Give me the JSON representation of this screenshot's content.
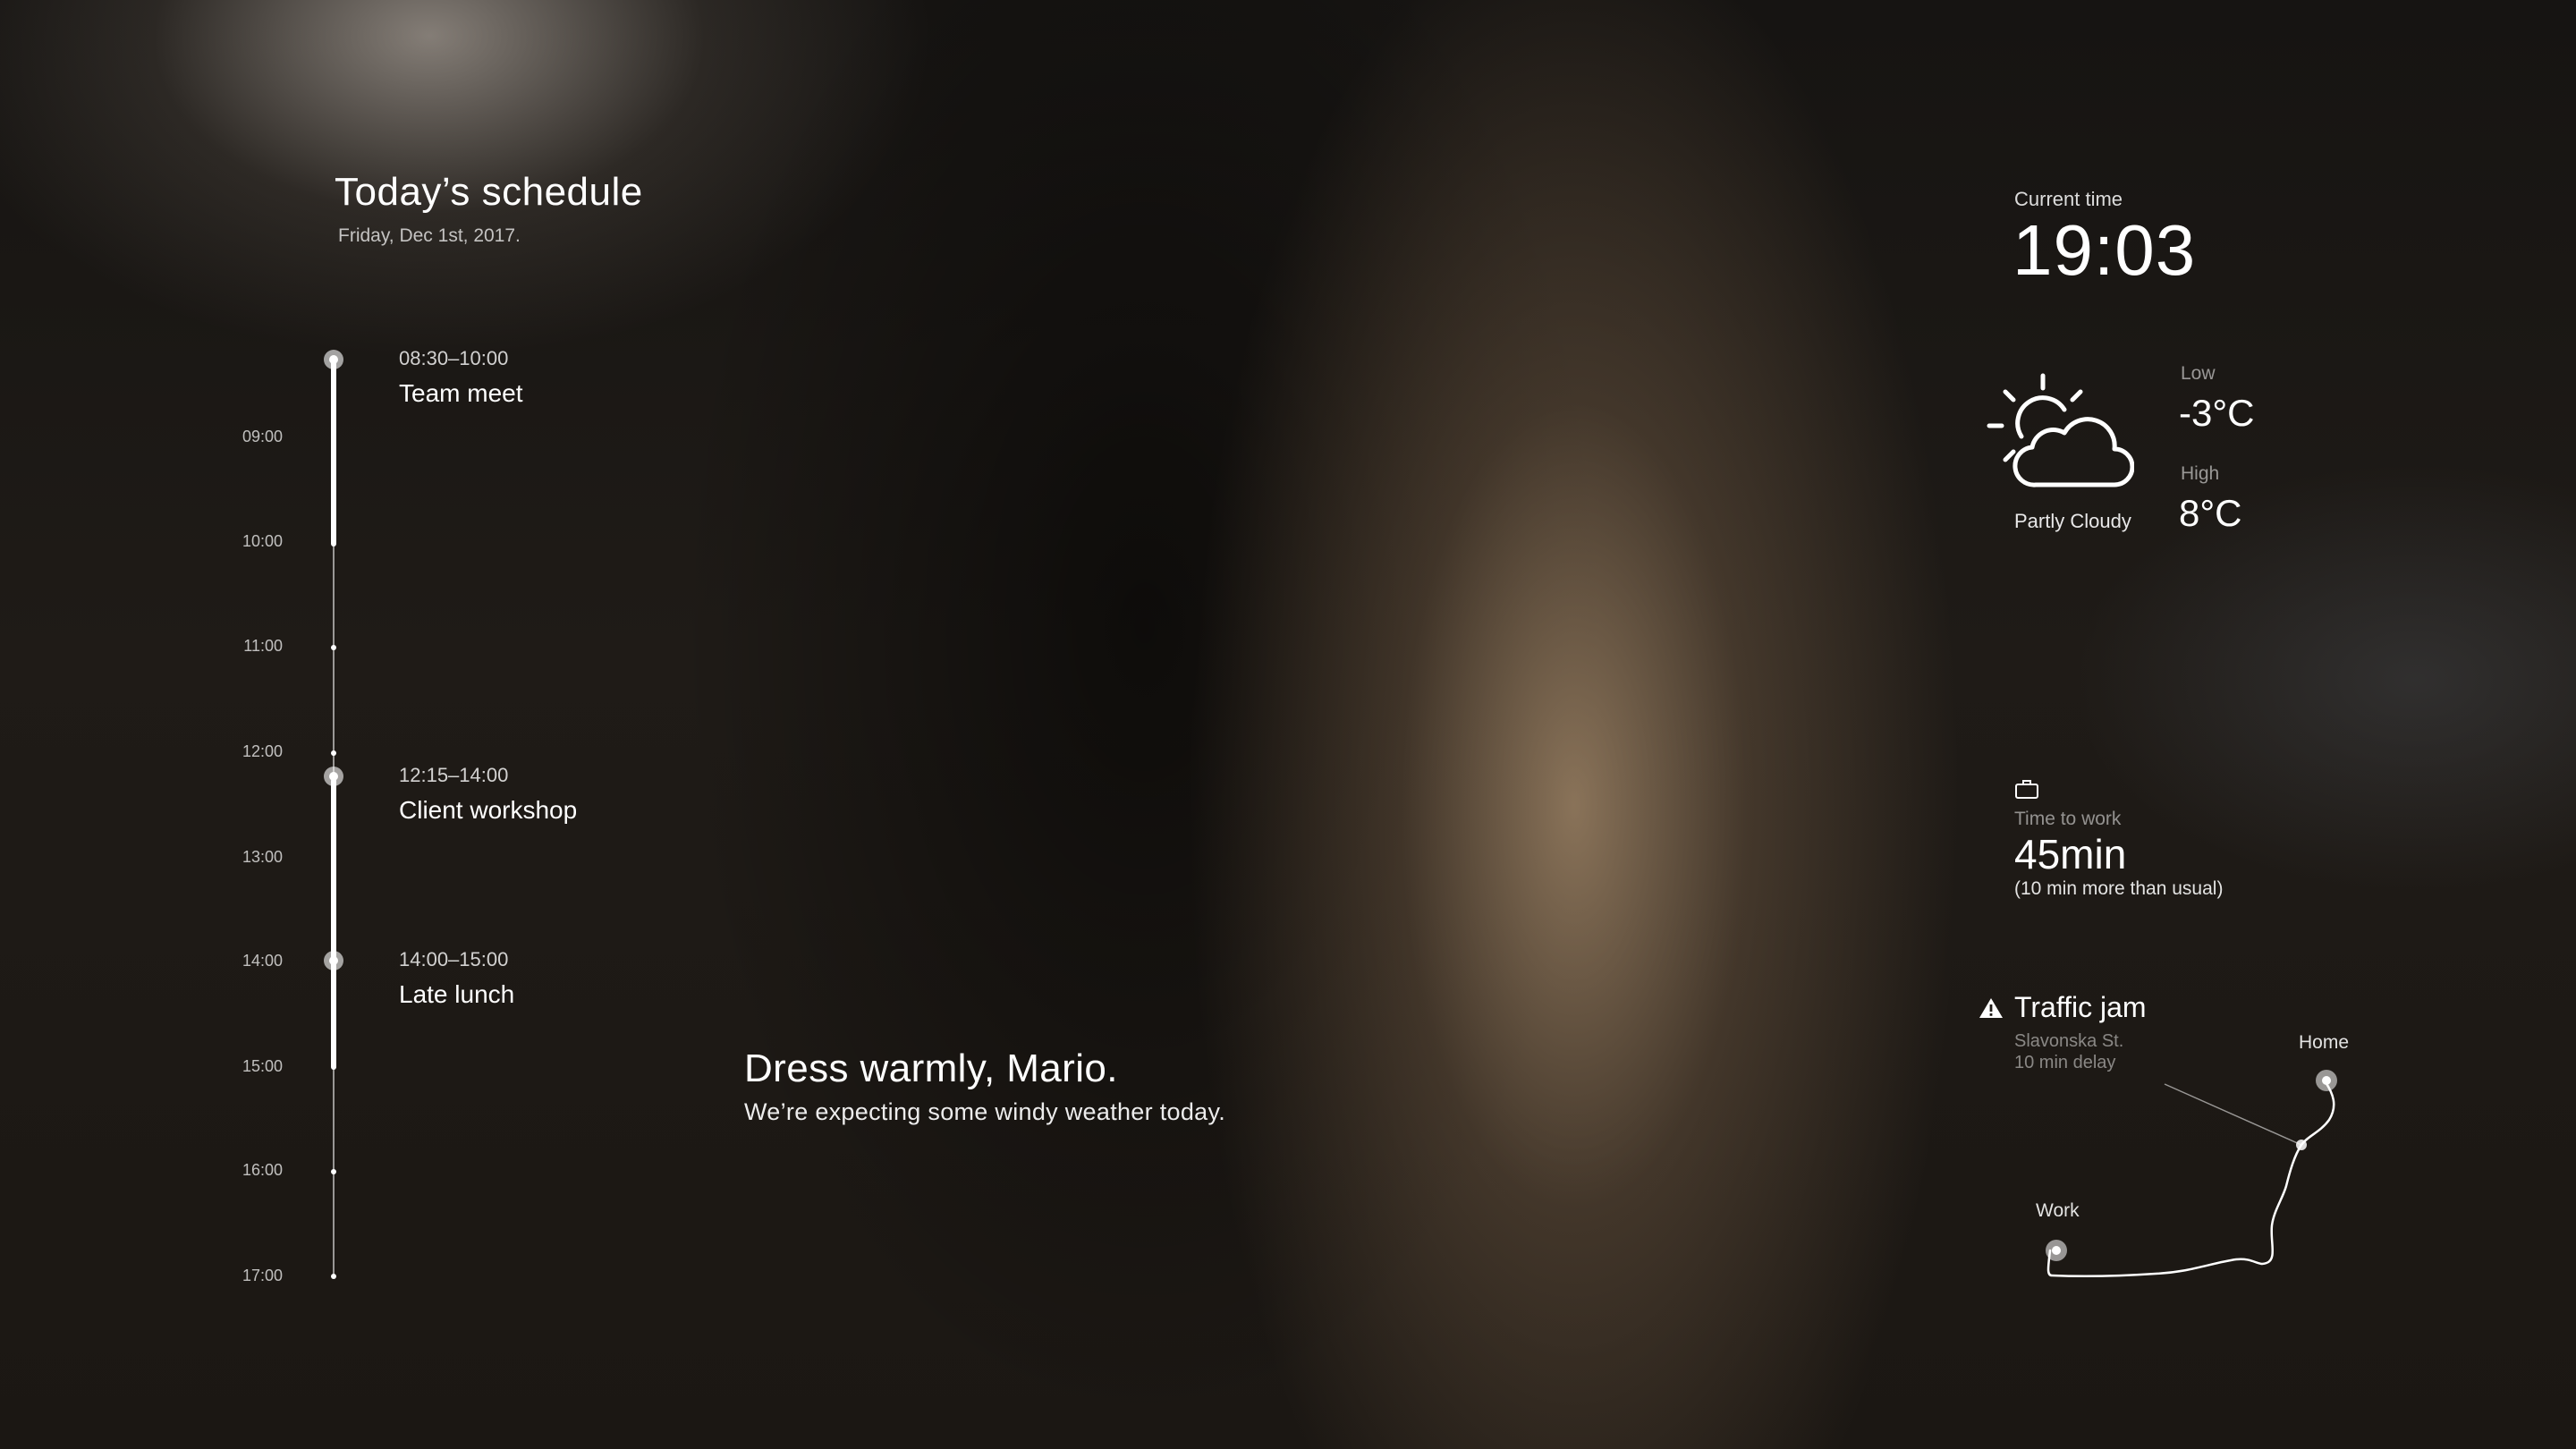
{
  "schedule": {
    "title": "Today’s schedule",
    "date": "Friday, Dec 1st, 2017.",
    "hours": [
      "09:00",
      "10:00",
      "11:00",
      "12:00",
      "13:00",
      "14:00",
      "15:00",
      "16:00",
      "17:00"
    ],
    "events": [
      {
        "time": "08:30–10:00",
        "name": "Team meet"
      },
      {
        "time": "12:15–14:00",
        "name": "Client workshop"
      },
      {
        "time": "14:00–15:00",
        "name": "Late lunch"
      }
    ]
  },
  "message": {
    "title": "Dress warmly, Mario.",
    "subtitle": "We’re expecting some windy weather today."
  },
  "clock": {
    "label": "Current time",
    "value": "19:03"
  },
  "weather": {
    "icon": "partly-cloudy-icon",
    "condition": "Partly Cloudy",
    "low_label": "Low",
    "low_value": "-3°C",
    "high_label": "High",
    "high_value": "8°C"
  },
  "commute": {
    "icon": "briefcase-icon",
    "label": "Time to work",
    "value": "45min",
    "note": "(10 min more than usual)"
  },
  "traffic": {
    "icon": "warning-icon",
    "title": "Traffic jam",
    "street": "Slavonska St.",
    "delay": "10 min delay",
    "home_label": "Home",
    "work_label": "Work"
  }
}
